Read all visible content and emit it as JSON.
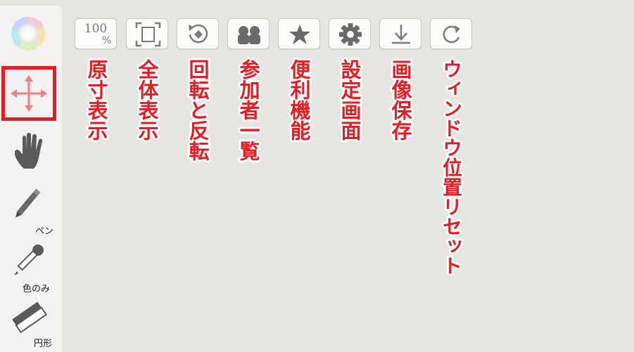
{
  "sidebar": {
    "color_wheel": {
      "icon": "color-wheel-icon"
    },
    "move": {
      "icon": "move-arrows-icon"
    },
    "hand": {
      "icon": "hand-icon"
    },
    "pen": {
      "icon": "pen-icon",
      "label": "ペン"
    },
    "eyedropper": {
      "icon": "eyedropper-icon",
      "label": "色のみ"
    },
    "eraser": {
      "icon": "eraser-icon",
      "label": "円形"
    }
  },
  "toolbar": {
    "actual_size": {
      "top": "100",
      "bottom": "%",
      "annotation": "原寸表示"
    },
    "fit_screen": {
      "icon": "fit-screen-icon",
      "annotation": "全体表示"
    },
    "rotate_flip": {
      "icon": "rotate-flip-icon",
      "annotation": "回転と反転"
    },
    "participants": {
      "icon": "participants-icon",
      "annotation": "参加者一覧"
    },
    "favorites": {
      "icon": "star-icon",
      "annotation": "便利機能"
    },
    "settings": {
      "icon": "gear-icon",
      "annotation": "設定画面"
    },
    "save_image": {
      "icon": "download-icon",
      "annotation": "画像保存"
    },
    "reset_window": {
      "icon": "refresh-icon",
      "annotation": "ウィンドウ位置リセット"
    }
  },
  "colors": {
    "accent": "#e51c23",
    "icon_gray": "#7a7a7a",
    "move_arrows": "#f08080"
  }
}
